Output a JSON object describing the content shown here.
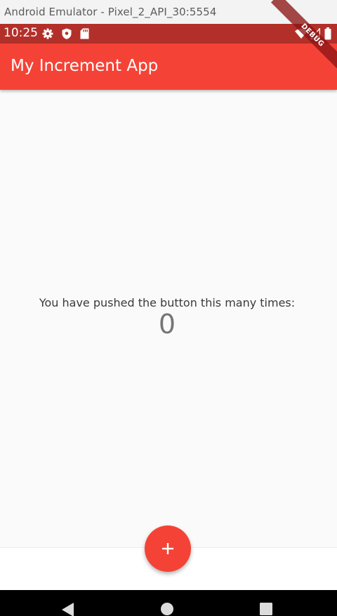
{
  "window": {
    "title": "Android Emulator - Pixel_2_API_30:5554"
  },
  "status_bar": {
    "time": "10:25",
    "left_icons": [
      "gear-icon",
      "shield-icon",
      "sd-card-icon"
    ],
    "right_icons": [
      "wifi-icon",
      "signal-icon",
      "battery-icon"
    ],
    "color": "#b3302a"
  },
  "app_bar": {
    "title": "My Increment App",
    "color": "#f44336"
  },
  "debug_banner": {
    "label": "DEBUG"
  },
  "main": {
    "message": "You have pushed the button this many times:",
    "counter": "0"
  },
  "fab": {
    "icon": "plus-icon",
    "color": "#f44336"
  },
  "navigation_bar": {
    "buttons": [
      "back-icon",
      "home-icon",
      "recents-icon"
    ]
  }
}
